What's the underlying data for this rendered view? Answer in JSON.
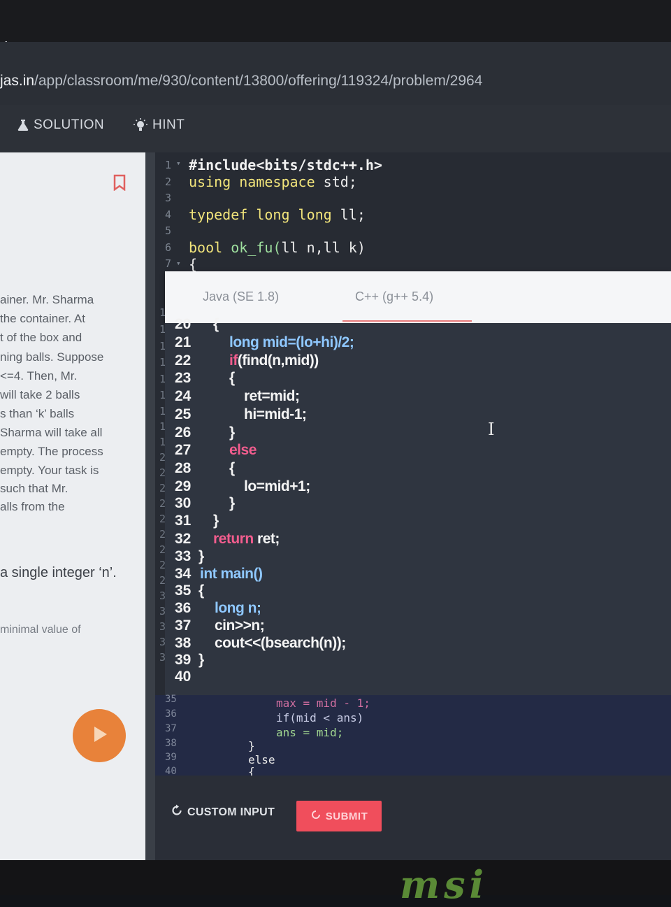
{
  "browser": {
    "url_domain": "jas.in",
    "url_path": "/app/classroom/me/930/content/13800/offering/119324/problem/2964"
  },
  "tabs": [
    {
      "label": "SOLUTION",
      "icon": "flask-icon"
    },
    {
      "label": "HINT",
      "icon": "lightbulb-icon"
    }
  ],
  "problem_lines": [
    "ainer. Mr. Sharma",
    "the container. At",
    "t of the box and",
    "ning balls. Suppose",
    "<=4. Then, Mr.",
    " will take 2 balls",
    "s than ‘k’ balls",
    "Sharma will take all",
    "empty. The process",
    "empty. Your task is",
    "such that Mr.",
    "alls from the"
  ],
  "problem_input": "a single integer ‘n’.",
  "problem_output": " minimal value of",
  "editor_top": {
    "line_numbers": [
      "1",
      "2",
      "3",
      "4",
      "5",
      "6",
      "7"
    ],
    "lines": [
      {
        "t1": "#include<bits/stdc++.h>"
      },
      {
        "t1": "using",
        "t2": " namespace ",
        "t3": "std;"
      },
      {
        "t1": ""
      },
      {
        "t1": "typedef",
        "t2": " long long ",
        "t3": "ll;"
      },
      {
        "t1": ""
      },
      {
        "t1": "bool",
        "t2": " ok_fu(",
        "t3": "ll n,ll k)"
      },
      {
        "t1": "{"
      }
    ]
  },
  "languages": [
    "Java (SE 1.8)",
    "C++ (g++ 5.4)"
  ],
  "overlay_code": {
    "line_numbers": [
      "20",
      "21",
      "22",
      "23",
      "24",
      "25",
      "26",
      "27",
      "28",
      "29",
      "30",
      "31",
      "32",
      "33",
      "34",
      "35",
      "36",
      "37",
      "38",
      "39",
      "40"
    ],
    "lines": [
      {
        "indent": 2,
        "text": "{"
      },
      {
        "indent": 3,
        "text": "long mid=(lo+hi)/2;"
      },
      {
        "indent": 3,
        "kw": "if",
        "text": "(find(n,mid))"
      },
      {
        "indent": 3,
        "text": "{"
      },
      {
        "indent": 4,
        "text": "ret=mid;"
      },
      {
        "indent": 4,
        "text": "hi=mid-1;"
      },
      {
        "indent": 3,
        "text": "}"
      },
      {
        "indent": 3,
        "kw": "else",
        "text": ""
      },
      {
        "indent": 3,
        "text": "{"
      },
      {
        "indent": 4,
        "text": "lo=mid+1;"
      },
      {
        "indent": 3,
        "text": "}"
      },
      {
        "indent": 2,
        "text": "}"
      },
      {
        "indent": 2,
        "kw": "return",
        "text": " ret;"
      },
      {
        "indent": 1,
        "text": "}"
      },
      {
        "indent": 1,
        "kw2": "int",
        "text": " main()"
      },
      {
        "indent": 1,
        "text": "{"
      },
      {
        "indent": 2,
        "text": "long n;"
      },
      {
        "indent": 2,
        "text": "cin>>n;"
      },
      {
        "indent": 2,
        "text": "cout<<(bsearch(n));"
      },
      {
        "indent": 1,
        "text": "}"
      },
      {
        "indent": 0,
        "text": ""
      }
    ]
  },
  "overlay_gutter": [
    "1",
    "1",
    "1",
    "1",
    "1",
    "1",
    "1",
    "1",
    "1",
    "2",
    "2",
    "2",
    "2",
    "2",
    "2",
    "2",
    "2",
    "2",
    "3",
    "3",
    "3",
    "3",
    "3"
  ],
  "lower_code": {
    "line_numbers": [
      "35",
      "36",
      "37",
      "38",
      "39",
      "40"
    ],
    "lines": [
      {
        "text": "max = mid - 1;"
      },
      {
        "text": "if(mid < ans)"
      },
      {
        "text": "ans = mid;"
      },
      {
        "text": "}"
      },
      {
        "text": "else"
      },
      {
        "text": "{"
      }
    ]
  },
  "actions": {
    "custom_input": "CUSTOM INPUT",
    "submit": "SUBMIT"
  },
  "brand": "msi",
  "colors": {
    "accent_submit": "#f04e5c",
    "play_button": "#e8823a",
    "keyword_pink": "#f25d8e",
    "keyword_blue": "#8fc8ff",
    "bookmark": "#e0605f"
  }
}
